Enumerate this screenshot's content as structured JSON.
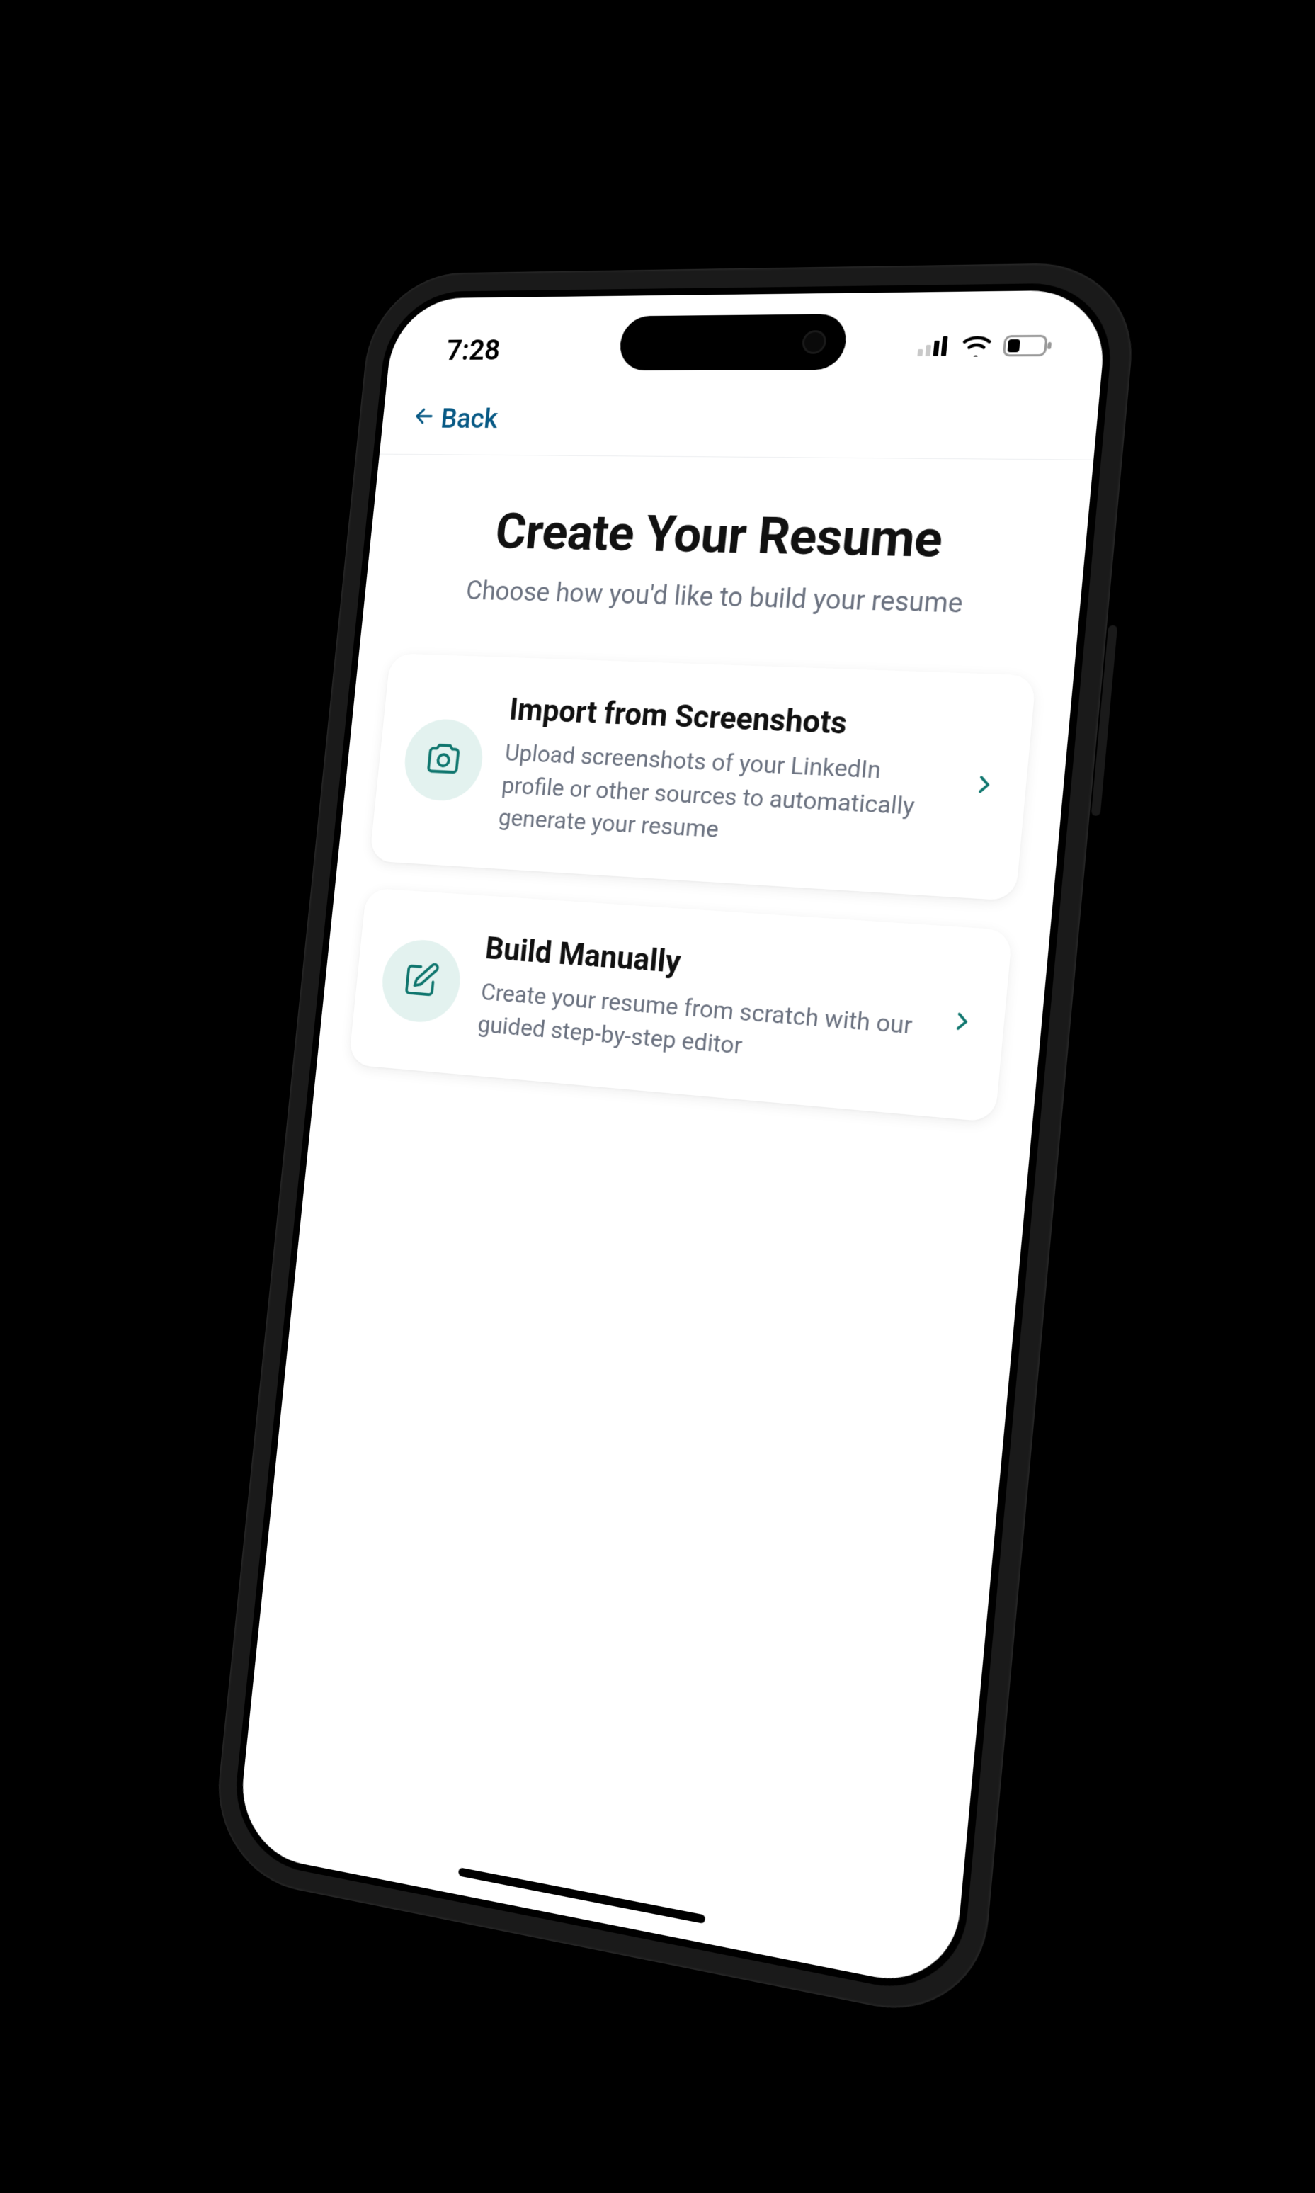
{
  "status": {
    "time": "7:28"
  },
  "nav": {
    "back_label": "Back"
  },
  "header": {
    "title": "Create Your Resume",
    "subtitle": "Choose how you'd like to build your resume"
  },
  "options": [
    {
      "icon": "camera-icon",
      "title": "Import from Screenshots",
      "desc": "Upload screenshots of your LinkedIn profile or other sources to automatically generate your resume"
    },
    {
      "icon": "edit-icon",
      "title": "Build Manually",
      "desc": "Create your resume from scratch with our guided step-by-step editor"
    }
  ],
  "colors": {
    "accent": "#0f766e",
    "back_link": "#075985",
    "icon_bg": "#e3f2ef",
    "muted": "#6b7280"
  }
}
